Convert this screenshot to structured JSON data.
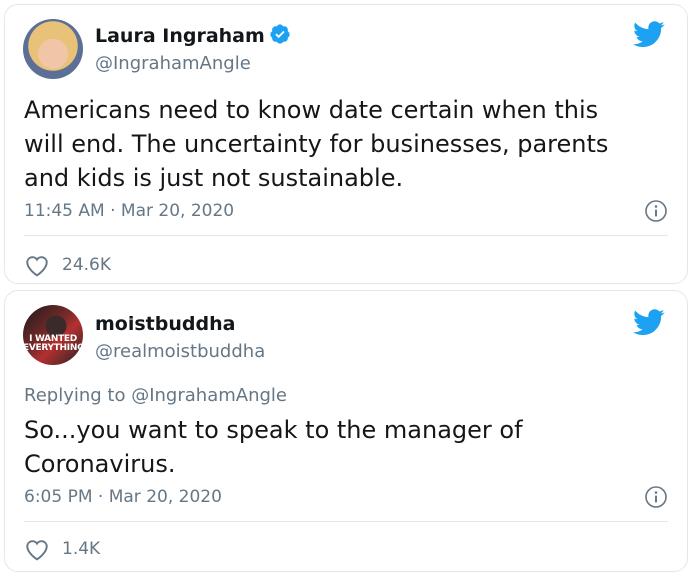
{
  "tweets": [
    {
      "name": "Laura Ingraham",
      "handle": "@IngrahamAngle",
      "verified": true,
      "text": "Americans need to know date certain when this\nwill end.  The uncertainty for businesses, parents\nand kids is just not sustainable.",
      "time": "11:45 AM",
      "separator": "·",
      "date": "Mar 20, 2020",
      "likes": "24.6K",
      "avatar_icon": "avatar-photo"
    },
    {
      "name": "moistbuddha",
      "handle": "@realmoistbuddha",
      "verified": false,
      "avatar_text": "I WANTED EVERYTHING",
      "replying_prefix": "Replying to",
      "replying_to": "@IngrahamAngle",
      "text": "So...you want to speak to the manager of\nCoronavirus.",
      "time": "6:05 PM",
      "separator": "·",
      "date": "Mar 20, 2020",
      "likes": "1.4K"
    }
  ],
  "colors": {
    "twitter_blue": "#1da1f2",
    "text_primary": "#14171a",
    "text_secondary": "#657786",
    "border": "#e1e8ed"
  }
}
